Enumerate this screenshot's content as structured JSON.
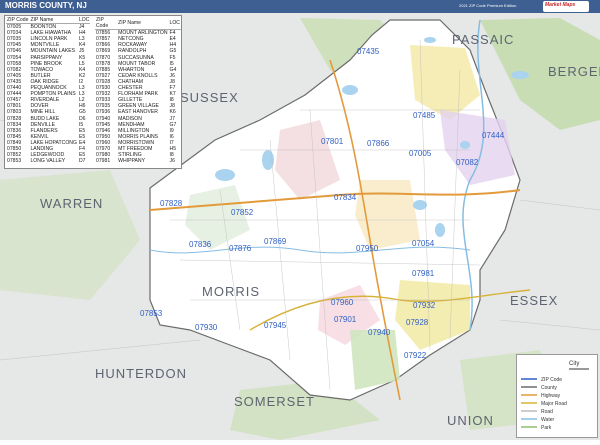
{
  "header": {
    "title": "MORRIS COUNTY, NJ",
    "edition": "2021 ZIP Code Premium Edition",
    "logo_text": "Market Maps"
  },
  "legend": {
    "columns": [
      "ZIP Code",
      "ZIP Name",
      "LOC"
    ],
    "left_rows": [
      [
        "07005",
        "BOONTON",
        "J4"
      ],
      [
        "07034",
        "LAKE HIAWATHA",
        "H4"
      ],
      [
        "07035",
        "LINCOLN PARK",
        "L3"
      ],
      [
        "07045",
        "MONTVILLE",
        "K4"
      ],
      [
        "07046",
        "MOUNTAIN LAKES",
        "J5"
      ],
      [
        "07054",
        "PARSIPPANY",
        "K5"
      ],
      [
        "07058",
        "PINE BROOK",
        "L5"
      ],
      [
        "07082",
        "TOWACO",
        "K4"
      ],
      [
        "07405",
        "BUTLER",
        "K2"
      ],
      [
        "07435",
        "OAK RIDGE",
        "I2"
      ],
      [
        "07440",
        "PEQUANNOCK",
        "L3"
      ],
      [
        "07444",
        "POMPTON PLAINS",
        "L3"
      ],
      [
        "07457",
        "RIVERDALE",
        "L2"
      ],
      [
        "07801",
        "DOVER",
        "H6"
      ],
      [
        "07803",
        "MINE HILL",
        "G5"
      ],
      [
        "07828",
        "BUDD LAKE",
        "D6"
      ],
      [
        "07834",
        "DENVILLE",
        "I5"
      ],
      [
        "07836",
        "FLANDERS",
        "E5"
      ],
      [
        "07845",
        "KENVIL",
        "E5"
      ],
      [
        "07849",
        "LAKE HOPATCONG",
        "E4"
      ],
      [
        "07850",
        "LANDING",
        "F4"
      ],
      [
        "07852",
        "LEDGEWOOD",
        "E5"
      ],
      [
        "07853",
        "LONG VALLEY",
        "D7"
      ]
    ],
    "right_rows": [
      [
        "07856",
        "MOUNT ARLINGTON",
        "F4"
      ],
      [
        "07857",
        "NETCONG",
        "E4"
      ],
      [
        "07866",
        "ROCKAWAY",
        "H4"
      ],
      [
        "07869",
        "RANDOLPH",
        "G5"
      ],
      [
        "07870",
        "SUCCASUNNA",
        "F5"
      ],
      [
        "07878",
        "MOUNT TABOR",
        "I5"
      ],
      [
        "07885",
        "WHARTON",
        "G4"
      ],
      [
        "07927",
        "CEDAR KNOLLS",
        "J6"
      ],
      [
        "07928",
        "CHATHAM",
        "J8"
      ],
      [
        "07930",
        "CHESTER",
        "F7"
      ],
      [
        "07932",
        "FLORHAM PARK",
        "K7"
      ],
      [
        "07933",
        "GILLETTE",
        "I8"
      ],
      [
        "07935",
        "GREEN VILLAGE",
        "J8"
      ],
      [
        "07936",
        "EAST HANOVER",
        "K6"
      ],
      [
        "07940",
        "MADISON",
        "J7"
      ],
      [
        "07945",
        "MENDHAM",
        "G7"
      ],
      [
        "07946",
        "MILLINGTON",
        "I9"
      ],
      [
        "07950",
        "MORRIS PLAINS",
        "I6"
      ],
      [
        "07960",
        "MORRISTOWN",
        "I7"
      ],
      [
        "07970",
        "MT FREEDOM",
        "H5"
      ],
      [
        "07980",
        "STIRLING",
        "I8"
      ],
      [
        "07981",
        "WHIPPANY",
        "J6"
      ]
    ]
  },
  "map": {
    "regions": [
      "PASSAIC",
      "SUSSEX",
      "BERGEN",
      "WARREN",
      "MORRIS",
      "ESSEX",
      "HUNTERDON",
      "SOMERSET",
      "UNION"
    ],
    "zip_labels": [
      "07435",
      "07485",
      "07444",
      "07801",
      "07866",
      "07005",
      "07082",
      "07828",
      "07852",
      "07834",
      "07836",
      "07869",
      "07876",
      "07930",
      "07950",
      "07054",
      "07981",
      "07853",
      "07945",
      "07960",
      "07932",
      "07928",
      "07940",
      "07922",
      "07901"
    ],
    "colors": {
      "header": "#3d5f91",
      "county_fill": "#ffffff",
      "outside": "#e9eaea",
      "water": "#a9d3ef",
      "park": "#c7dfb4",
      "zip_label": "#2f5fc4",
      "region_label": "#5d6470"
    }
  },
  "info_panel": {
    "scale_label": "City",
    "rows": [
      "ZIP Code",
      "County",
      "Highway",
      "Major Road",
      "Road",
      "Water",
      "Park"
    ]
  }
}
